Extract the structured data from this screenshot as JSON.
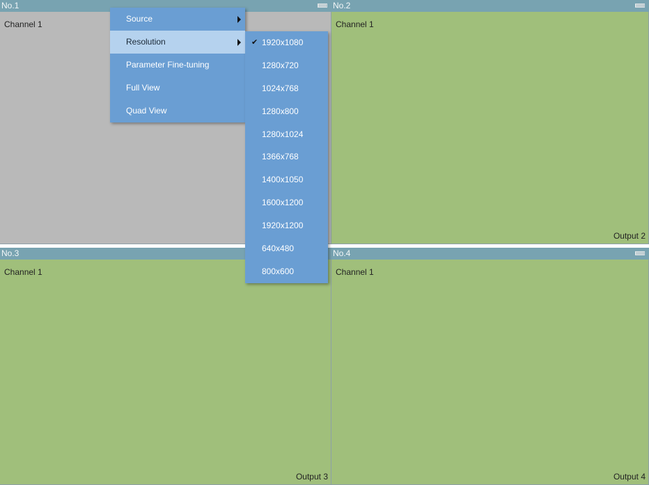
{
  "panels": [
    {
      "title": "No.1",
      "channel": "Channel 1",
      "output": ""
    },
    {
      "title": "No.2",
      "channel": "Channel 1",
      "output": "Output 2"
    },
    {
      "title": "No.3",
      "channel": "Channel 1",
      "output": "Output 3"
    },
    {
      "title": "No.4",
      "channel": "Channel 1",
      "output": "Output 4"
    }
  ],
  "context_menu": {
    "items": [
      {
        "label": "Source",
        "has_submenu": true
      },
      {
        "label": "Resolution",
        "has_submenu": true,
        "highlighted": true
      },
      {
        "label": "Parameter Fine-tuning"
      },
      {
        "label": "Full View"
      },
      {
        "label": "Quad View"
      }
    ]
  },
  "resolution_submenu": {
    "selected": "1920x1080",
    "items": [
      "1920x1080",
      "1280x720",
      "1024x768",
      "1280x800",
      "1280x1024",
      "1366x768",
      "1400x1050",
      "1600x1200",
      "1920x1200",
      "640x480",
      "800x600"
    ]
  },
  "colors": {
    "header": "#78a3b1",
    "panel_inactive": "#b9b9b9",
    "panel_active": "#a0bf7b",
    "menu": "#6a9ed3",
    "menu_highlight": "#b5d2ee"
  }
}
